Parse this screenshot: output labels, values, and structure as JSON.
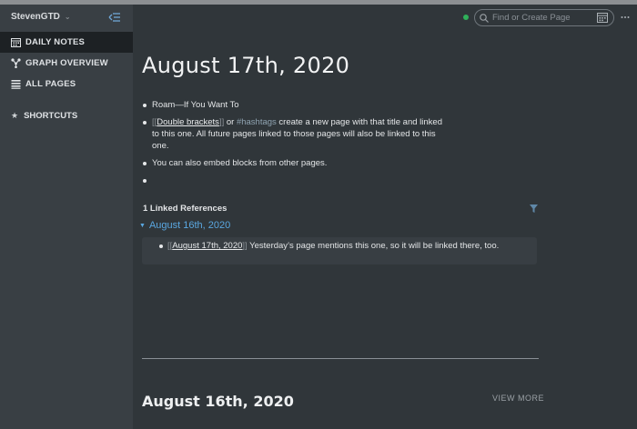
{
  "sidebar": {
    "graph_name": "StevenGTD",
    "items": [
      {
        "label": "DAILY NOTES",
        "icon": "calendar-icon",
        "active": true
      },
      {
        "label": "GRAPH OVERVIEW",
        "icon": "graph-icon",
        "active": false
      },
      {
        "label": "ALL PAGES",
        "icon": "list-icon",
        "active": false
      }
    ],
    "shortcuts_label": "SHORTCUTS"
  },
  "topbar": {
    "search_placeholder": "Find or Create Page",
    "sync_status_color": "#2fb05a"
  },
  "page": {
    "title": "August 17th, 2020",
    "blocks": {
      "b1": "Roam—If You Want To",
      "b2_open": "[[",
      "b2_link": "Double brackets",
      "b2_close": "]]",
      "b2_or": " or ",
      "b2_tag": "#hashtags",
      "b2_rest": " create a new page with that title and linked to this one. All future pages linked to those pages will also be linked to this one.",
      "b3": "You can also embed blocks from other pages."
    },
    "linked_refs": {
      "title": "1 Linked References",
      "page": "August 16th, 2020",
      "block_open": "[[",
      "block_link": "August 17th, 2020",
      "block_close": "]]",
      "block_rest": " Yesterday’s page mentions this one, so it will be linked there, too."
    }
  },
  "next": {
    "title": "August 16th, 2020",
    "view_more": "VIEW MORE"
  },
  "colors": {
    "background": "#30363a",
    "sidebar": "#393f44",
    "accent_link": "#5aa7e0"
  }
}
